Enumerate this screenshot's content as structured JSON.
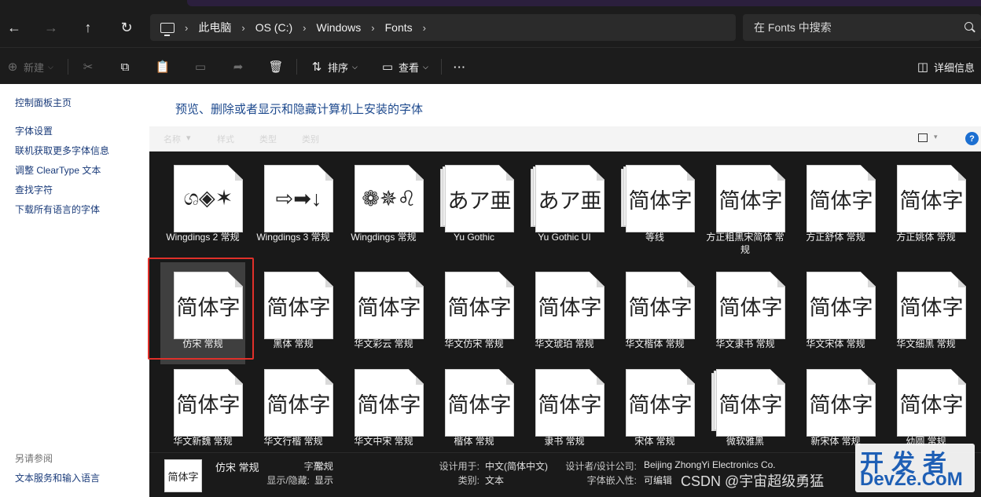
{
  "address_bar": {
    "crumbs": [
      "此电脑",
      "OS (C:)",
      "Windows",
      "Fonts"
    ],
    "search_placeholder": "在 Fonts 中搜索"
  },
  "command_bar": {
    "new_label": "新建",
    "sort_label": "排序",
    "view_label": "查看",
    "more_label": "···",
    "details_label": "详细信息"
  },
  "left_pane": {
    "links": [
      "控制面板主页",
      "字体设置",
      "联机获取更多字体信息",
      "调整 ClearType 文本",
      "查找字符",
      "下载所有语言的字体"
    ],
    "see_also_title": "另请参阅",
    "see_also_links": [
      "文本服务和输入语言"
    ]
  },
  "main": {
    "heading": "预览、删除或者显示和隐藏计算机上安装的字体",
    "column_headers": [
      "名称",
      "样式",
      "类型",
      "类别"
    ],
    "help_label": "?"
  },
  "fonts": [
    {
      "name": "Wingdings 2 常规",
      "sample": "ශ◈✶",
      "stack": false
    },
    {
      "name": "Wingdings 3 常规",
      "sample": "⇨➡↓",
      "stack": false
    },
    {
      "name": "Wingdings 常规",
      "sample": "❁✵♌",
      "stack": false
    },
    {
      "name": "Yu Gothic",
      "sample": "あア亜",
      "stack": true
    },
    {
      "name": "Yu Gothic UI",
      "sample": "あア亜",
      "stack": true
    },
    {
      "name": "等线",
      "sample": "简体字",
      "stack": true
    },
    {
      "name": "方正粗黑宋简体 常规",
      "sample": "简体字",
      "stack": false
    },
    {
      "name": "方正舒体 常规",
      "sample": "简体字",
      "stack": false
    },
    {
      "name": "方正姚体 常规",
      "sample": "简体字",
      "stack": false
    },
    {
      "name": "仿宋 常规",
      "sample": "简体字",
      "stack": false
    },
    {
      "name": "黑体 常规",
      "sample": "简体字",
      "stack": false
    },
    {
      "name": "华文彩云 常规",
      "sample": "简体字",
      "stack": false
    },
    {
      "name": "华文仿宋 常规",
      "sample": "简体字",
      "stack": false
    },
    {
      "name": "华文琥珀 常规",
      "sample": "简体字",
      "stack": false
    },
    {
      "name": "华文楷体 常规",
      "sample": "简体字",
      "stack": false
    },
    {
      "name": "华文隶书 常规",
      "sample": "简体字",
      "stack": false
    },
    {
      "name": "华文宋体 常规",
      "sample": "简体字",
      "stack": false
    },
    {
      "name": "华文细黑 常规",
      "sample": "简体字",
      "stack": false
    },
    {
      "name": "华文新魏 常规",
      "sample": "简体字",
      "stack": false
    },
    {
      "name": "华文行楷 常规",
      "sample": "简体字",
      "stack": false
    },
    {
      "name": "华文中宋 常规",
      "sample": "简体字",
      "stack": false
    },
    {
      "name": "楷体 常规",
      "sample": "简体字",
      "stack": false
    },
    {
      "name": "隶书 常规",
      "sample": "简体字",
      "stack": false
    },
    {
      "name": "宋体 常规",
      "sample": "简体字",
      "stack": false
    },
    {
      "name": "微软雅黑",
      "sample": "简体字",
      "stack": true
    },
    {
      "name": "新宋体 常规",
      "sample": "简体字",
      "stack": false
    },
    {
      "name": "幼圆 常规",
      "sample": "简体字",
      "stack": false
    }
  ],
  "selected_font": "仿宋 常规",
  "details": {
    "thumb_sample": "简体字",
    "name": "仿宋 常规",
    "style_key": "字形:",
    "style_val": "常规",
    "showhide_key": "显示/隐藏:",
    "showhide_val": "显示",
    "designed_for_key": "设计用于:",
    "designed_for_val": "中文(简体中文)",
    "category_key": "类别:",
    "category_val": "文本",
    "designer_key": "设计者/设计公司:",
    "designer_val": "Beijing ZhongYi Electronics Co.",
    "embed_key": "字体嵌入性:",
    "embed_val": "可编辑"
  },
  "watermark": {
    "csdn": "CSDN @宇宙超级勇猛",
    "brand_cn": "开发者",
    "brand_en": "DevZe.CoM"
  },
  "colors": {
    "accent": "#1c6fd1",
    "selection_outline": "#e0302a"
  }
}
